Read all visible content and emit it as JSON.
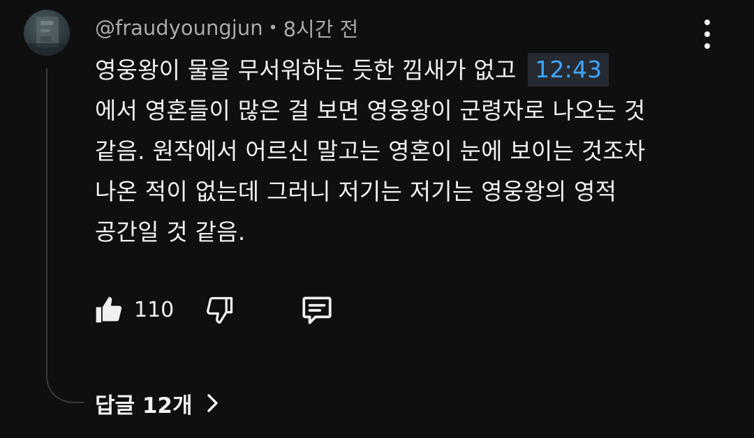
{
  "comment": {
    "author": "@fraudyoungjun",
    "separator": "•",
    "time": "8시간 전",
    "lines": [
      "영웅왕이 물을 무서워하는 듯한 낌새가 없고",
      "에서 영혼들이 많은 걸 보면 영웅왕이 군령자로 나오는 것",
      "같음. 원작에서 어르신 말고는 영혼이 눈에 보이는 것조차",
      "나온 적이 없는데 그러니 저기는 저기는 영웅왕의 영적",
      "공간일 것 같음."
    ],
    "timestamp_link": "12:43",
    "like_count": "110",
    "replies_label": "답글 12개"
  },
  "icons": {
    "more": "more-vert-icon",
    "like": "thumbs-up-icon",
    "dislike": "thumbs-down-icon",
    "reply": "comment-icon",
    "replies_chevron": "chevron-right-icon"
  },
  "colors": {
    "background": "#0f0f0f",
    "text": "#f1f1f1",
    "secondary_text": "#aaaaaa",
    "link": "#3ea6ff",
    "timestamp_bg": "#262b33"
  }
}
